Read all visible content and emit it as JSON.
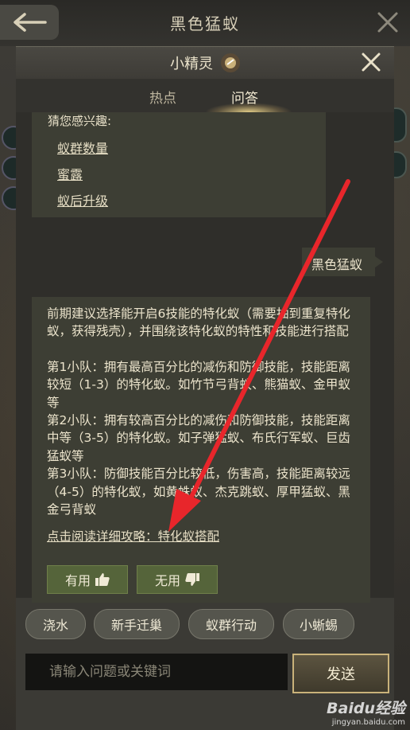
{
  "topbar": {
    "title": "黑色猛蚁"
  },
  "panel": {
    "title": "小精灵",
    "tabs": [
      {
        "label": "热点"
      },
      {
        "label": "问答"
      }
    ],
    "active_tab": "问答"
  },
  "suggest": {
    "heading": "猜您感兴趣:",
    "links": [
      "蚁群数量",
      "蜜露",
      "蚁后升级"
    ]
  },
  "user_message": "黑色猛蚁",
  "answer": {
    "paragraph1": "前期建议选择能开启6技能的特化蚁（需要抽到重复特化蚁，获得残壳），并围绕该特化蚁的特性和技能进行搭配",
    "team1": "第1小队：拥有最高百分比的减伤和防御技能，技能距离较短（1-3）的特化蚁。如竹节弓背蚁、熊猫蚁、金甲蚁等",
    "team2": "第2小队：拥有较高百分比的减伤和防御技能，技能距离中等（3-5）的特化蚁。如子弹猛蚁、布氏行军蚁、巨齿猛蚁等",
    "team3": "第3小队：防御技能百分比较低，伤害高，技能距离较远（4-5）的特化蚁，如黄蛛蚁、杰克跳蚁、厚甲猛蚁、黑金弓背蚁",
    "link": "点击阅读详细攻略：特化蚁搭配",
    "useful_label": "有用",
    "useless_label": "无用"
  },
  "quick_actions": [
    "浇水",
    "新手迁巢",
    "蚁群行动",
    "小蜥蜴"
  ],
  "input": {
    "placeholder": "请输入问题或关键词",
    "value": ""
  },
  "send_label": "发送",
  "watermark": {
    "main": "Baidu经验",
    "sub": "jingyan.baidu.com"
  },
  "colors": {
    "accent_green": "#55643a",
    "arrow_red": "#e8262b",
    "send_border": "#c9b27a"
  }
}
